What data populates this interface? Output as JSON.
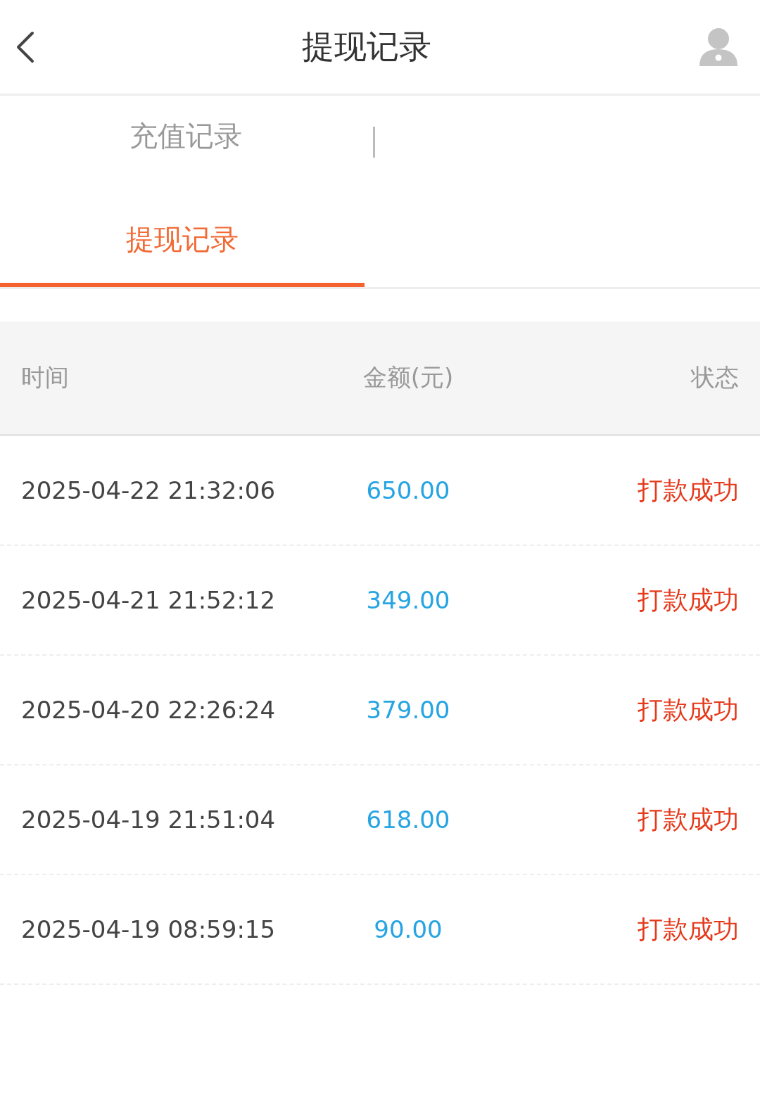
{
  "header": {
    "title": "提现记录"
  },
  "tabs": [
    {
      "label": "充值记录",
      "selected": false
    },
    {
      "label": "提现记录",
      "selected": true
    }
  ],
  "table": {
    "columns": [
      "时间",
      "金额(元)",
      "状态"
    ],
    "rows": [
      {
        "time": "2025-04-22 21:32:06",
        "amount": "650.00",
        "status": "打款成功"
      },
      {
        "time": "2025-04-21 21:52:12",
        "amount": "349.00",
        "status": "打款成功"
      },
      {
        "time": "2025-04-20 22:26:24",
        "amount": "379.00",
        "status": "打款成功"
      },
      {
        "time": "2025-04-19 21:51:04",
        "amount": "618.00",
        "status": "打款成功"
      },
      {
        "time": "2025-04-19 08:59:15",
        "amount": "90.00",
        "status": "打款成功"
      }
    ]
  }
}
